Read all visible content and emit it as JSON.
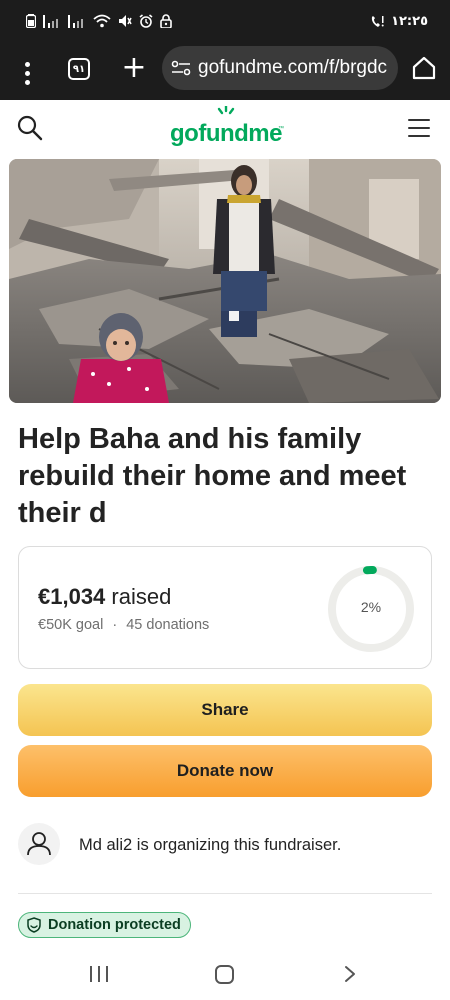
{
  "status_bar": {
    "time": "١٢:٢٥",
    "icons": [
      "battery-icon",
      "signal-icon",
      "signal-icon",
      "wifi-icon",
      "mute-icon",
      "alarm-icon",
      "lock-icon",
      "call-icon"
    ]
  },
  "browser": {
    "tab_count": "٩١",
    "url": "gofundme.com/f/brgdc",
    "icons": [
      "menu-kebab-icon",
      "tabs-icon",
      "plus-icon",
      "site-settings-icon",
      "home-icon"
    ]
  },
  "site_header": {
    "logo_text": "gofundme",
    "logo_tm": "™",
    "brand_color": "#02a95c"
  },
  "hero": {
    "alt_icon": "campaign-photo"
  },
  "campaign": {
    "title": "Help Baha and his family rebuild their home and meet their d"
  },
  "progress": {
    "raised_amount": "€1,034",
    "raised_suffix": "raised",
    "goal": "€50K goal",
    "separator": "·",
    "donations": "45 donations",
    "percent_label": "2%",
    "percent_value": 2
  },
  "actions": {
    "share_label": "Share",
    "donate_label": "Donate now"
  },
  "organizer": {
    "text": "Md ali2 is organizing this fundraiser."
  },
  "badge": {
    "label": "Donation protected"
  },
  "nav_bar": {
    "icons": [
      "recent-apps-icon",
      "home-button-icon",
      "back-icon"
    ]
  }
}
